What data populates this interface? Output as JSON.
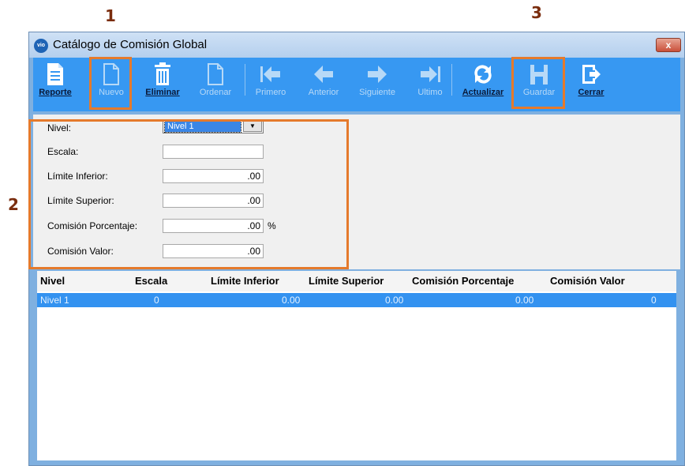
{
  "callouts": [
    "1",
    "2",
    "3"
  ],
  "window": {
    "title": "Catálogo de Comisión Global",
    "logo_text": "vio",
    "close_glyph": "x"
  },
  "toolbar": {
    "buttons": [
      {
        "label": "Reporte",
        "icon": "report-icon",
        "enabled": true
      },
      {
        "label": "Nuevo",
        "icon": "new-document-icon",
        "enabled": false
      },
      {
        "label": "Eliminar",
        "icon": "trash-icon",
        "enabled": true
      },
      {
        "label": "Ordenar",
        "icon": "sort-document-icon",
        "enabled": false
      },
      {
        "label": "Primero",
        "icon": "first-arrow-icon",
        "enabled": false
      },
      {
        "label": "Anterior",
        "icon": "previous-arrow-icon",
        "enabled": false
      },
      {
        "label": "Siguiente",
        "icon": "next-arrow-icon",
        "enabled": false
      },
      {
        "label": "Ultimo",
        "icon": "last-arrow-icon",
        "enabled": false
      },
      {
        "label": "Actualizar",
        "icon": "refresh-icon",
        "enabled": true
      },
      {
        "label": "Guardar",
        "icon": "save-icon",
        "enabled": false
      },
      {
        "label": "Cerrar",
        "icon": "exit-icon",
        "enabled": true
      }
    ]
  },
  "form": {
    "nivel": {
      "label": "Nivel:",
      "value": "Nivel 1"
    },
    "escala": {
      "label": "Escala:",
      "value": ""
    },
    "limite_inferior": {
      "label": "Límite Inferior:",
      "value": ".00"
    },
    "limite_superior": {
      "label": "Límite Superior:",
      "value": ".00"
    },
    "comision_porcentaje": {
      "label": "Comisión Porcentaje:",
      "value": ".00",
      "suffix": "%"
    },
    "comision_valor": {
      "label": "Comisión Valor:",
      "value": ".00"
    }
  },
  "grid": {
    "columns": [
      "Nivel",
      "Escala",
      "Límite Inferior",
      "Límite Superior",
      "Comisión Porcentaje",
      "Comisión Valor"
    ],
    "rows": [
      [
        "Nivel 1",
        "0",
        "0.00",
        "0.00",
        "0.00",
        "0"
      ]
    ]
  },
  "colors": {
    "toolbar": "#3798f2",
    "highlight": "#e57a2c",
    "selected_row": "#3392f0"
  }
}
